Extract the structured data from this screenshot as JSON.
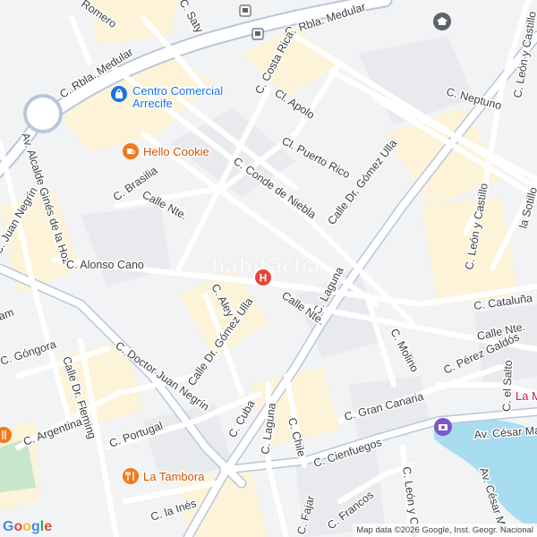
{
  "colors": {
    "background": "#f1f3f4",
    "major_road": "#ffffff",
    "major_road_casing": "#b9c6d9",
    "minor_road": "#ffffff",
    "block_yellow": "#fdf3d9",
    "block_grey": "#e8eaed",
    "water": "#a8dcf0",
    "park": "#c8e6c9",
    "poi_blue": "#1a73e8",
    "poi_orange": "#f27a1a",
    "poi_purple": "#7e57c2",
    "hospital_red": "#ea4335"
  },
  "pois": {
    "shopping_center": {
      "name_line1": "Centro Comercial",
      "name_line2": "Arrecife",
      "icon": "shopping-bag-icon"
    },
    "hello_cookie": {
      "name": "Hello Cookie",
      "icon": "coffee-cup-icon"
    },
    "la_tambora": {
      "name": "La Tambora",
      "icon": "fork-knife-icon"
    },
    "hospital": {
      "icon": "hospital-icon",
      "letter": "H"
    },
    "la_marina": {
      "name": "La M",
      "icon": "camera-icon"
    }
  },
  "streets": {
    "rbla_medular_top": "C. Rbla. Medular",
    "rbla_medular_left": "C. Rbla. Medular",
    "costa_rica": "C. Costa Rica",
    "apolo": "Cl. Apolo",
    "neptuno": "C. Neptuno",
    "leon_castillo_top": "C. León y Castillo",
    "leon_castillo_right": "C. León y Castillo",
    "puerto_rico": "Cl. Puerto Rico",
    "conde_niebla": "C. Conde de Niebla",
    "gomez_ulla_top": "Calle Dr. Gómez Ulla",
    "gomez_ulla_mid": "Calle Dr. Gómez Ulla",
    "brasilia": "C. Brasilia",
    "nte_upper": "Calle Nte.",
    "alcalde_gines": "Av. Alcalde Ginés de la Hoz",
    "alonso_cano": "C. Alonso Cano",
    "juan_negrin_left": "C. Juan Negrín",
    "doctor_juan_negrin": "C. Doctor Juan Negrín",
    "laguna_top": "C. Laguna",
    "nte_lower": "Calle Nte.",
    "cataluna": "C. Cataluña",
    "nte_right": "Calle Nte.",
    "perez_galdos": "C. Pérez Galdós",
    "molino": "C. Molino",
    "aley": "C. Aley",
    "gongora": "C. Góngora",
    "dr_fleming": "Calle Dr. Fleming",
    "argentina": "C. Argentina",
    "portugal": "C. Portugal",
    "cuba": "C. Cuba",
    "laguna_bottom": "C. Laguna",
    "chile": "C. Chile",
    "gran_canaria": "C. Gran Canaria",
    "el_salto": "C. el Salto",
    "cienfuegos": "C. Cienfuegos",
    "cesar_manrique_top": "Av. César Manri",
    "cesar_manrique_right": "Av. César Ma",
    "leon_castillo_bottom": "C. León y Cas",
    "francos": "C. Francos",
    "ines": "C. la Inés",
    "fajardo": "C. Fajar",
    "la_sotilla": "la Sotillo",
    "street_top_left": "Romero",
    "street_top": "C. Saty",
    "am_left": "am"
  },
  "watermark": "habitaclia",
  "logo": {
    "g1": "G",
    "o1": "o",
    "o2": "o",
    "g2": "g",
    "l": "l",
    "e": "e"
  },
  "attribution": "Map data ©2026 Google, Inst. Geogr. Nacional"
}
